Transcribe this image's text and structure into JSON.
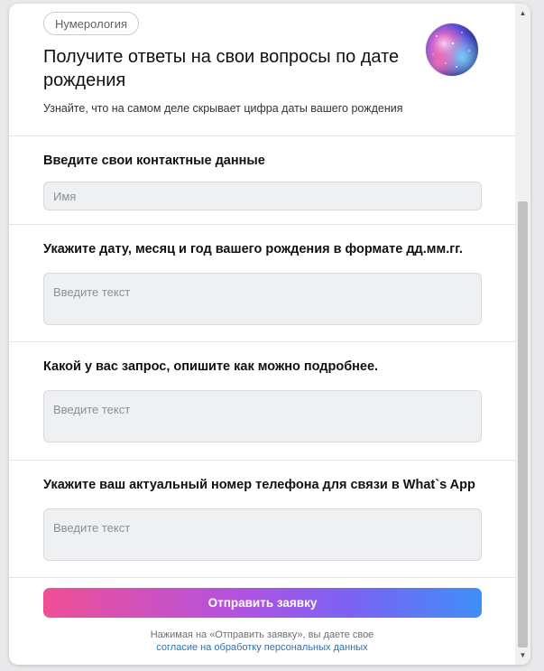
{
  "header": {
    "tag": "Нумерология",
    "title": "Получите ответы на свои вопросы по дате рождения",
    "subtitle": "Узнайте, что на самом деле скрывает цифра даты вашего рождения",
    "avatar_icon": "cosmic-nebula-avatar"
  },
  "form": {
    "contact": {
      "label": "Введите свои контактные данные",
      "name_placeholder": "Имя",
      "name_value": ""
    },
    "birthdate": {
      "label": "Укажите дату, месяц и год вашего рождения в формате дд.мм.гг.",
      "placeholder": "Введите текст",
      "value": ""
    },
    "request": {
      "label": "Какой у вас запрос, опишите как можно подробнее.",
      "placeholder": "Введите текст",
      "value": ""
    },
    "phone": {
      "label": "Укажите ваш актуальный номер телефона для связи в What`s App",
      "placeholder": "Введите текст",
      "value": ""
    },
    "submit_label": "Отправить заявку",
    "consent_text": "Нажимая на «Отправить заявку», вы даете свое",
    "consent_link": "согласие на обработку персональных данных"
  },
  "colors": {
    "button_gradient_start": "#f04f95",
    "button_gradient_end": "#3f8ef9",
    "link": "#2d6fb5"
  }
}
